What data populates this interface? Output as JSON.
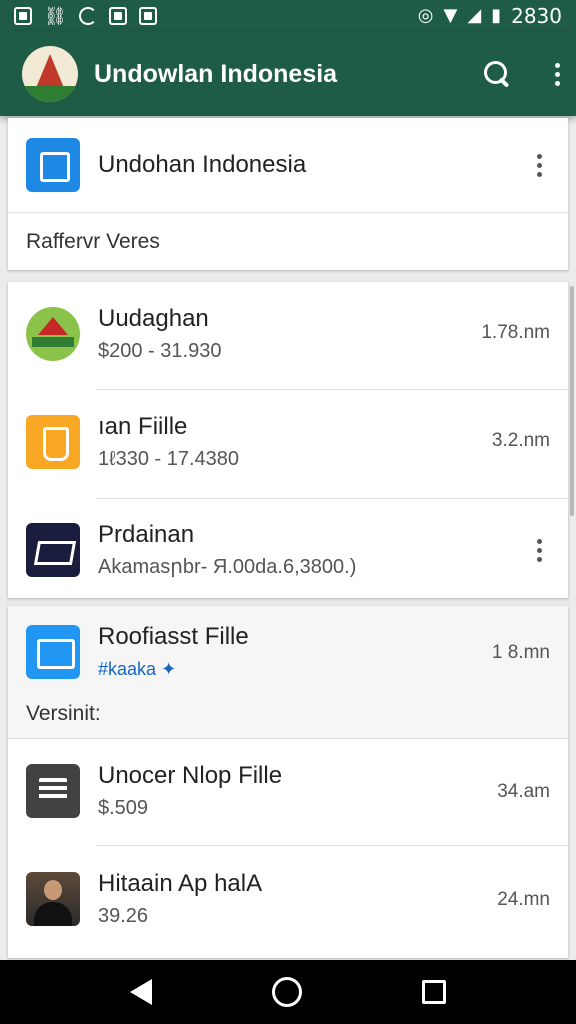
{
  "status_bar": {
    "time": "2830"
  },
  "app_bar": {
    "title": "Undowlan Indonesia",
    "search_icon": "search-icon",
    "menu_icon": "more-vert-icon"
  },
  "header_card": {
    "title": "Undohan Indonesia",
    "section_label": "Raffervr Veres"
  },
  "list_items": [
    {
      "title": "Uudaghan",
      "subtitle": "$200 - 31.930",
      "meta": "1.78.nm",
      "icon": "temple-icon"
    },
    {
      "title": "ıan Fiille",
      "subtitle": "1ℓ330 - 17.4380",
      "meta": "3.2.nm",
      "icon": "file-icon"
    },
    {
      "title": "Prdainan",
      "subtitle": "Akamasրbr- Я.00da.6,3800.)",
      "meta": "",
      "icon": "media-icon"
    }
  ],
  "featured_card": {
    "title": "Roofiasst Fille",
    "tag": "#kaaka",
    "meta": "1 8.mn",
    "section_label": "Versinit:"
  },
  "more_items": [
    {
      "title": "Unocer Nlop Fille",
      "subtitle": "$.509",
      "meta": "34.am",
      "icon": "sheet-icon"
    },
    {
      "title": "Hitaain Ap halA",
      "subtitle": "39.26",
      "meta": "24.mn",
      "icon": "person-photo-icon"
    }
  ],
  "colors": {
    "app_bar": "#1f5c45",
    "accent_blue": "#1e88e5",
    "link": "#1565c0"
  }
}
